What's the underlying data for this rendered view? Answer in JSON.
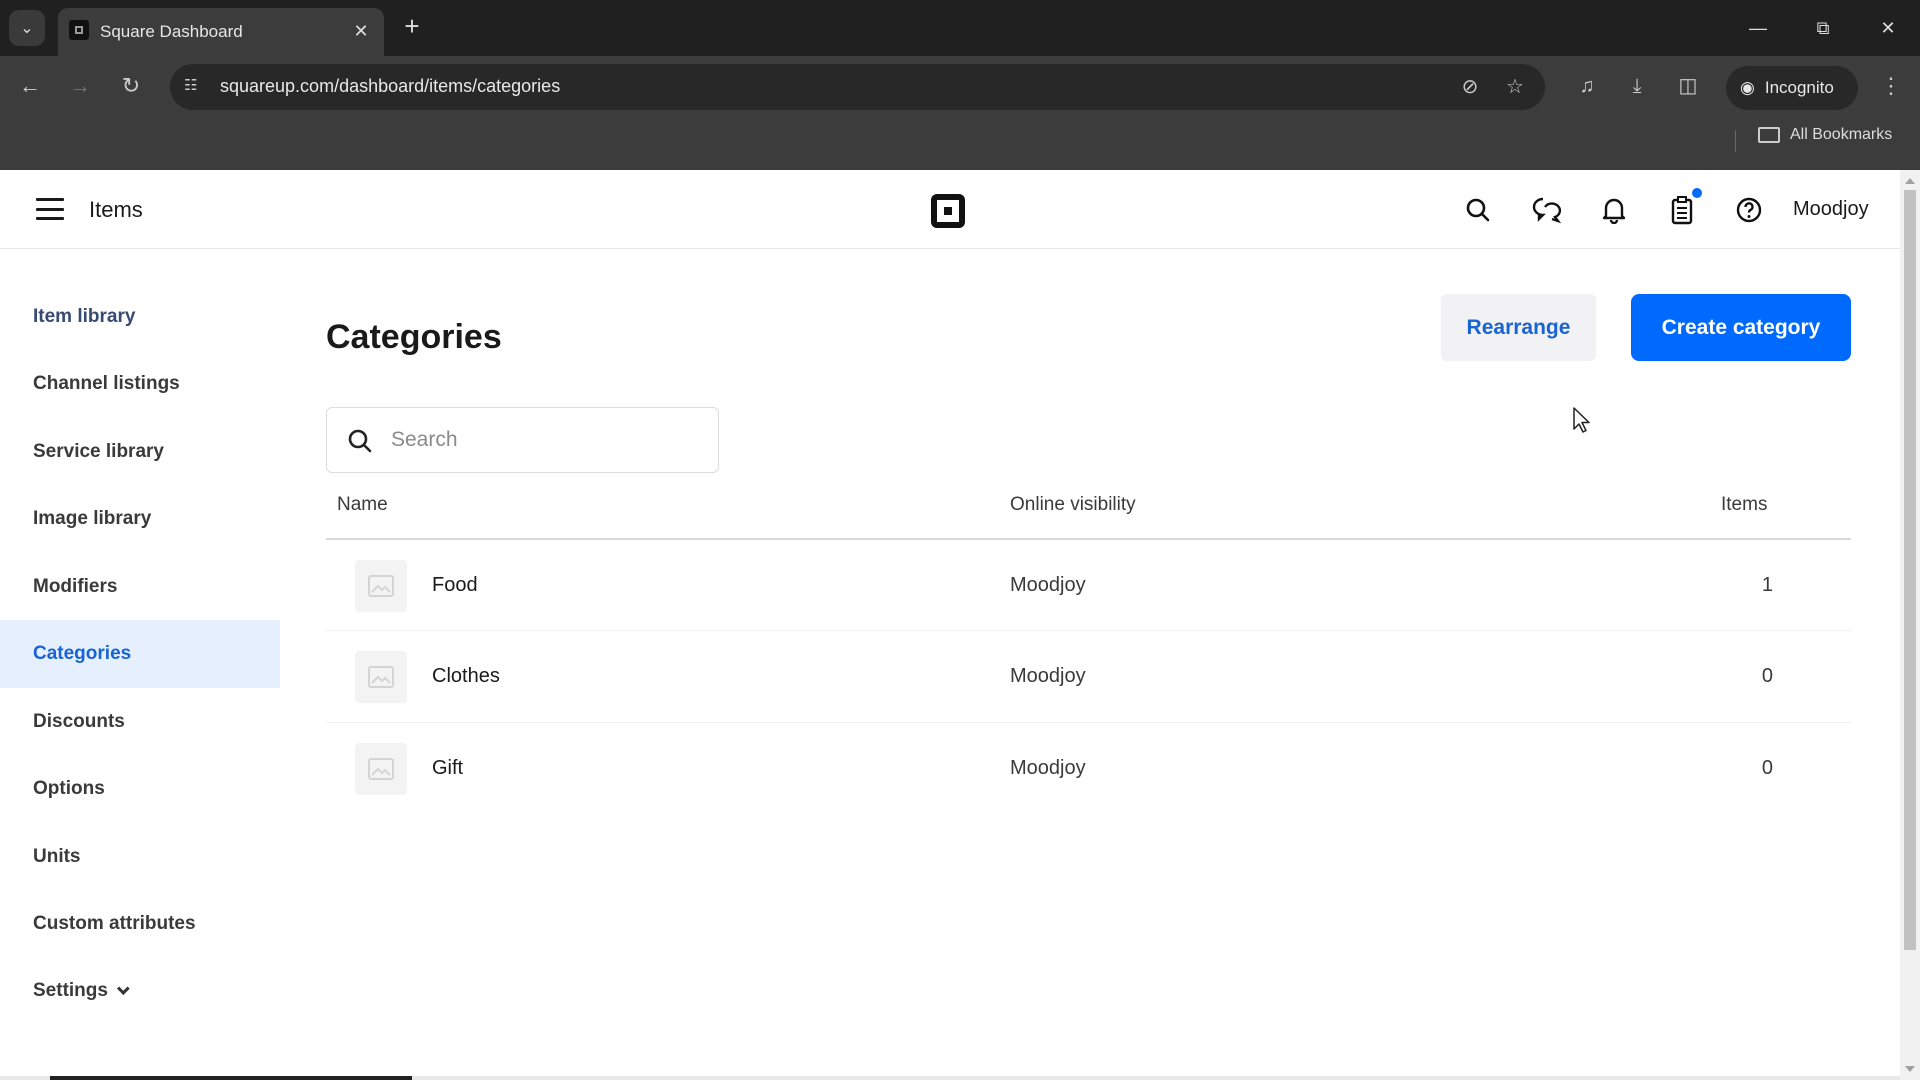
{
  "browser": {
    "tab_title": "Square Dashboard",
    "url": "squareup.com/dashboard/items/categories",
    "incognito_label": "Incognito",
    "bookmarks_label": "All Bookmarks"
  },
  "header": {
    "title": "Items",
    "user": "Moodjoy",
    "icons": [
      "search-icon",
      "messages-icon",
      "bell-icon",
      "clipboard-icon",
      "help-icon"
    ]
  },
  "sidebar": {
    "items": [
      {
        "label": "Item library"
      },
      {
        "label": "Channel listings"
      },
      {
        "label": "Service library"
      },
      {
        "label": "Image library"
      },
      {
        "label": "Modifiers"
      },
      {
        "label": "Categories",
        "active": true
      },
      {
        "label": "Discounts"
      },
      {
        "label": "Options"
      },
      {
        "label": "Units"
      },
      {
        "label": "Custom attributes"
      },
      {
        "label": "Settings"
      }
    ]
  },
  "main": {
    "title": "Categories",
    "rearrange_label": "Rearrange",
    "create_label": "Create category",
    "search_placeholder": "Search",
    "columns": [
      "Name",
      "Online visibility",
      "Items"
    ],
    "rows": [
      {
        "name": "Food",
        "visibility": "Moodjoy",
        "items": "1"
      },
      {
        "name": "Clothes",
        "visibility": "Moodjoy",
        "items": "0"
      },
      {
        "name": "Gift",
        "visibility": "Moodjoy",
        "items": "0"
      }
    ]
  },
  "colors": {
    "accent": "#006aff",
    "active_nav_bg": "#e5effd",
    "active_nav_text": "#1864d4"
  }
}
